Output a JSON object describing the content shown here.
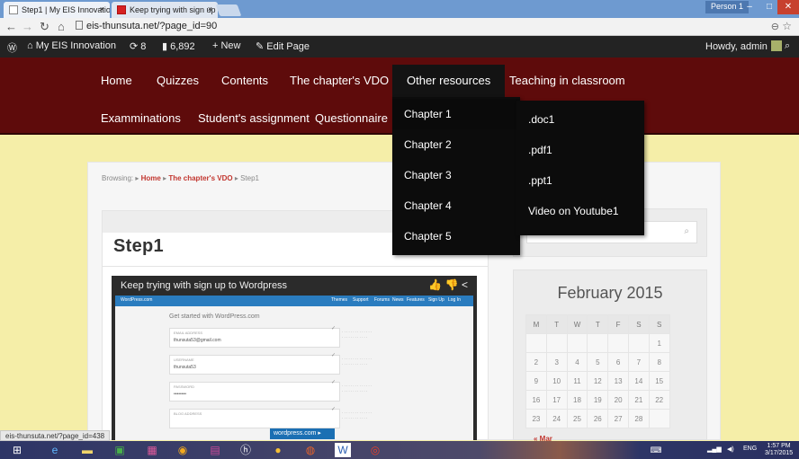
{
  "browser": {
    "tabs": [
      {
        "title": "Step1 | My EIS Innovation"
      },
      {
        "title": "Keep trying with sign up t"
      }
    ],
    "tab_close": "×",
    "person": "Person 1",
    "url": "eis-thunsuta.net/?page_id=90",
    "status_url": "eis-thunsuta.net/?page_id=438"
  },
  "adminbar": {
    "site_name": "My EIS Innovation",
    "updates": "8",
    "comments": "6,892",
    "new_label": "New",
    "edit_label": "Edit Page",
    "howdy": "Howdy, admin"
  },
  "nav": {
    "row1": [
      "Home",
      "Quizzes",
      "Contents",
      "The chapter's VDO",
      "Other resources",
      "Teaching in classroom"
    ],
    "row2": [
      "Examminations",
      "Student's assignment",
      "Questionnaire"
    ]
  },
  "dropdown_chapters": [
    "Chapter 1",
    "Chapter 2",
    "Chapter 3",
    "Chapter 4",
    "Chapter 5"
  ],
  "dropdown_files": [
    ".doc1",
    ".pdf1",
    ".ppt1",
    "Video on Youtube1"
  ],
  "breadcrumb": {
    "prefix": "Browsing:",
    "items": [
      "Home",
      "The chapter's VDO",
      "Step1"
    ]
  },
  "page_title": "Step1",
  "video": {
    "title": "Keep trying with sign up to Wordpress",
    "wp_logo": "WordPress.com",
    "wp_links": [
      "Themes",
      "Support",
      "Forums",
      "News",
      "Features",
      "Sign Up",
      "Log In"
    ],
    "heading": "Get started with WordPress.com",
    "fields": [
      {
        "label": "EMAIL ADDRESS",
        "value": "thunsuta53@gmail.com"
      },
      {
        "label": "USERNAME",
        "value": "thunsuta53"
      },
      {
        "label": "PASSWORD",
        "value": "••••••••"
      },
      {
        "label": "BLOG ADDRESS",
        "value": ""
      }
    ],
    "cta": "wordpress.com ▸"
  },
  "calendar": {
    "title": "February 2015",
    "days": [
      "M",
      "T",
      "W",
      "T",
      "F",
      "S",
      "S"
    ],
    "weeks": [
      [
        "",
        "",
        "",
        "",
        "",
        "",
        "1"
      ],
      [
        "2",
        "3",
        "4",
        "5",
        "6",
        "7",
        "8"
      ],
      [
        "9",
        "10",
        "11",
        "12",
        "13",
        "14",
        "15"
      ],
      [
        "16",
        "17",
        "18",
        "19",
        "20",
        "21",
        "22"
      ],
      [
        "23",
        "24",
        "25",
        "26",
        "27",
        "28",
        ""
      ]
    ],
    "prev": "« Mar"
  },
  "taskbar": {
    "lang": "ENG",
    "time": "1:57 PM",
    "date": "3/17/2015"
  }
}
